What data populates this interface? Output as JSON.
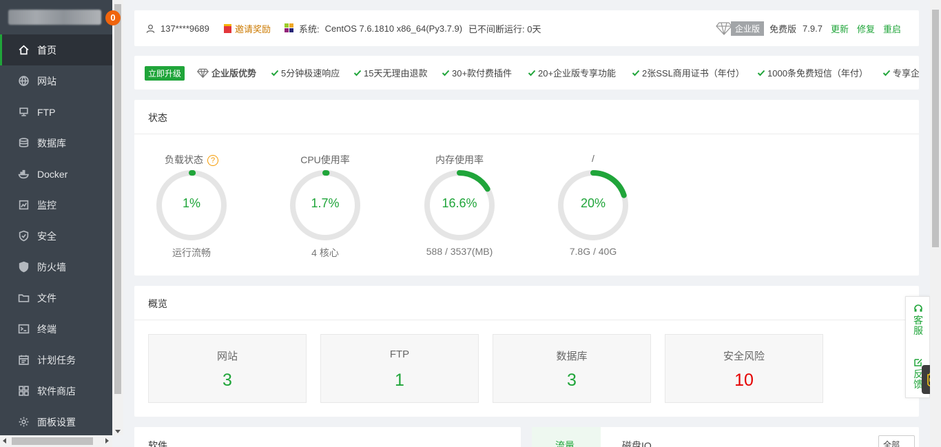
{
  "sidebar": {
    "badge": "0",
    "items": [
      {
        "label": "首页",
        "icon": "home-icon"
      },
      {
        "label": "网站",
        "icon": "globe-icon"
      },
      {
        "label": "FTP",
        "icon": "ftp-icon"
      },
      {
        "label": "数据库",
        "icon": "database-icon"
      },
      {
        "label": "Docker",
        "icon": "docker-icon"
      },
      {
        "label": "监控",
        "icon": "monitor-icon"
      },
      {
        "label": "安全",
        "icon": "shield-icon"
      },
      {
        "label": "防火墙",
        "icon": "firewall-icon"
      },
      {
        "label": "文件",
        "icon": "folder-icon"
      },
      {
        "label": "终端",
        "icon": "terminal-icon"
      },
      {
        "label": "计划任务",
        "icon": "calendar-icon"
      },
      {
        "label": "软件商店",
        "icon": "grid-icon"
      },
      {
        "label": "面板设置",
        "icon": "gear-icon"
      }
    ]
  },
  "topbar": {
    "user": "137****9689",
    "invite": "邀请奖励",
    "system_label": "系统:",
    "system_value": "CentOS 7.6.1810 x86_64(Py3.7.9)",
    "uptime": "已不间断运行: 0天",
    "enterprise_tag": "企业版",
    "edition": "免费版",
    "version": "7.9.7",
    "update": "更新",
    "repair": "修复",
    "restart": "重启"
  },
  "promo": {
    "upgrade": "立即升级",
    "title": "企业版优势",
    "features": [
      "5分钟极速响应",
      "15天无理由退款",
      "30+款付费插件",
      "20+企业版专享功能",
      "2张SSL商用证书（年付）",
      "1000条免费短信（年付）",
      "专享企"
    ]
  },
  "status": {
    "title": "状态",
    "gauges": [
      {
        "title": "负载状态",
        "value": "1%",
        "percent": 1,
        "sub": "运行流畅"
      },
      {
        "title": "CPU使用率",
        "value": "1.7%",
        "percent": 1.7,
        "sub": "4 核心"
      },
      {
        "title": "内存使用率",
        "value": "16.6%",
        "percent": 16.6,
        "sub": "588 / 3537(MB)"
      },
      {
        "title": "/",
        "value": "20%",
        "percent": 20,
        "sub": "7.8G / 40G"
      }
    ],
    "help": "?"
  },
  "overview": {
    "title": "概览",
    "boxes": [
      {
        "label": "网站",
        "value": "3"
      },
      {
        "label": "FTP",
        "value": "1"
      },
      {
        "label": "数据库",
        "value": "3"
      },
      {
        "label": "安全风险",
        "value": "10"
      }
    ]
  },
  "software": {
    "title": "软件"
  },
  "traffic": {
    "tab_flow": "流量",
    "tab_io": "磁盘IO",
    "select": "全部"
  },
  "float": {
    "service": "客服",
    "feedback": "反馈"
  },
  "colors": {
    "accent": "#20a53a",
    "danger": "#e50000",
    "sidebar": "#3c444d"
  }
}
